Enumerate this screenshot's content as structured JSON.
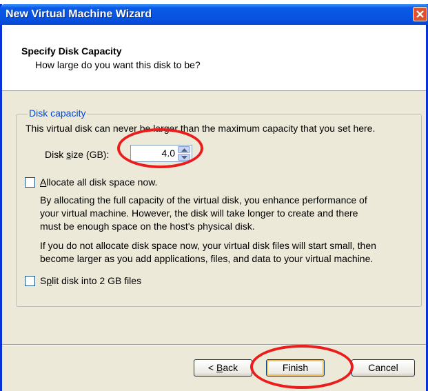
{
  "window": {
    "title": "New Virtual Machine Wizard"
  },
  "header": {
    "title": "Specify Disk Capacity",
    "subtitle": "How large do you want this disk to be?"
  },
  "group": {
    "legend": "Disk capacity",
    "description": "This virtual disk can never be larger than the maximum capacity that you set here.",
    "disk_size_label": "Disk size (GB):",
    "disk_size_value": "4.0"
  },
  "allocate": {
    "label": "Allocate all disk space now.",
    "checked": false,
    "para1_line1": "By allocating the full capacity of the virtual disk, you enhance performance of",
    "para1_line2": "your virtual machine.  However, the disk will take longer to create and there",
    "para1_line3": "must be enough space on the host's physical disk.",
    "para2_line1": "If you do not allocate disk space now, your virtual disk files will start small, then",
    "para2_line2": "become larger as you add applications, files, and data to your virtual machine."
  },
  "split": {
    "label": "Split disk into 2 GB files",
    "checked": false
  },
  "buttons": {
    "back": "< Back",
    "finish": "Finish",
    "cancel": "Cancel"
  },
  "colors": {
    "titlebar": "#0853e0",
    "annotation": "#ea1c1c",
    "legend": "#0046d5"
  }
}
